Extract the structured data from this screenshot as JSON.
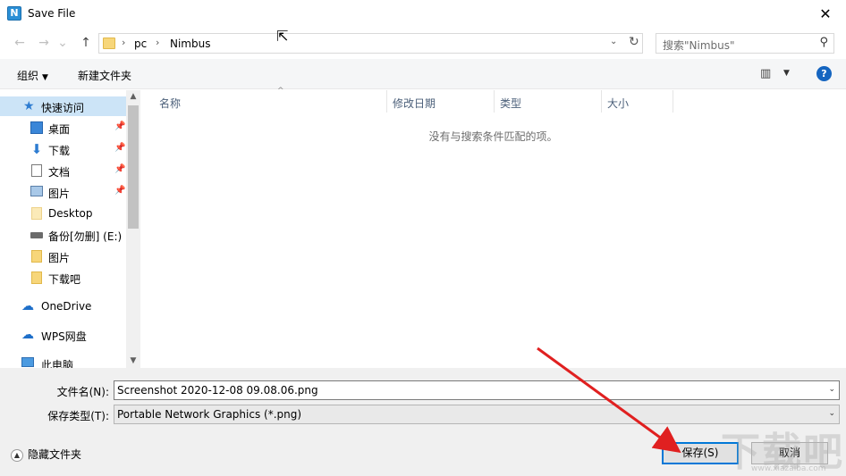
{
  "window": {
    "title": "Save File",
    "app_icon_letter": "N",
    "close_glyph": "✕"
  },
  "nav_buttons": {
    "back": "←",
    "forward": "→",
    "recent": "⌄",
    "up": "↑"
  },
  "address": {
    "crumbs": [
      "pc",
      "Nimbus"
    ],
    "separator": "›",
    "dropdown_glyph": "⌄",
    "refresh_glyph": "↻"
  },
  "search": {
    "placeholder": "搜索\"Nimbus\"",
    "icon_glyph": "⚲"
  },
  "toolbar": {
    "organize_label": "组织",
    "organize_caret": "▼",
    "new_folder_label": "新建文件夹",
    "view_glyph": "▥",
    "view_caret": "▼",
    "help_glyph": "?"
  },
  "nav": {
    "quick_access": "快速访问",
    "pin_glyph": "📌",
    "items": [
      {
        "label": "桌面"
      },
      {
        "label": "下载"
      },
      {
        "label": "文档"
      },
      {
        "label": "图片"
      },
      {
        "label": "Desktop"
      },
      {
        "label": "备份[勿删] (E:)"
      },
      {
        "label": "图片"
      },
      {
        "label": "下载吧"
      }
    ],
    "onedrive": "OneDrive",
    "wps": "WPS网盘",
    "this_pc": "此电脑",
    "scroll_up": "▲",
    "scroll_down": "▼"
  },
  "columns": {
    "name": "名称",
    "modified": "修改日期",
    "type": "类型",
    "size": "大小",
    "sort_caret": "^"
  },
  "file_list": {
    "empty_message": "没有与搜索条件匹配的项。"
  },
  "form": {
    "filename_label": "文件名(N):",
    "filename_value": "Screenshot 2020-12-08 09.08.06.png",
    "filetype_label": "保存类型(T):",
    "filetype_value": "Portable Network Graphics (*.png)",
    "dropdown_glyph": "⌄"
  },
  "footer": {
    "hide_folders_chevron": "▲",
    "hide_folders_label": "隐藏文件夹",
    "save_label": "保存(S)",
    "cancel_label": "取消"
  },
  "overlay": {
    "cursor_glyph": "⇱",
    "watermark": "下载吧",
    "watermark_url": "www.xiazaiba.com",
    "arrow_color": "#e02020"
  }
}
